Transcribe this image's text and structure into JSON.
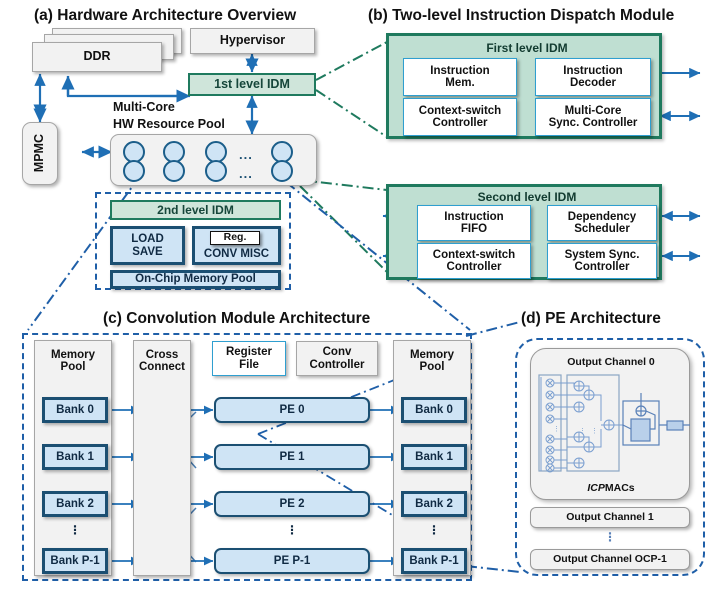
{
  "figure": {
    "panels": {
      "a": {
        "title": "(a) Hardware Architecture Overview"
      },
      "b": {
        "title": "(b) Two-level Instruction Dispatch Module"
      },
      "c": {
        "title": "(c) Convolution Module Architecture"
      },
      "d": {
        "title": "(d) PE Architecture"
      }
    }
  },
  "panel_a": {
    "ddr": "DDR",
    "hypervisor": "Hypervisor",
    "first_level_idm": "1st level IDM",
    "pool_label_line1": "Multi-Core",
    "pool_label_line2": "HW Resource Pool",
    "mpmc": "MPMC",
    "pool_ellipsis": "...",
    "core_rows": 2,
    "cores_per_row": 3
  },
  "panel_b": {
    "first": {
      "header": "First level IDM",
      "cells": [
        {
          "line1": "Instruction",
          "line2": "Mem."
        },
        {
          "line1": "Instruction",
          "line2": "Decoder"
        },
        {
          "line1": "Context-switch",
          "line2": "Controller"
        },
        {
          "line1": "Multi-Core",
          "line2": "Sync. Controller"
        }
      ]
    },
    "second": {
      "header": "Second level IDM",
      "cells": [
        {
          "line1": "Instruction",
          "line2": "FIFO"
        },
        {
          "line1": "Dependency",
          "line2": "Scheduler"
        },
        {
          "line1": "Context-switch",
          "line2": "Controller"
        },
        {
          "line1": "System Sync.",
          "line2": "Controller"
        }
      ]
    }
  },
  "panel_core": {
    "second_level_idm": "2nd  level IDM",
    "load_save_line1": "LOAD",
    "load_save_line2": "SAVE",
    "reg": "Reg.",
    "conv_misc": "CONV MISC",
    "on_chip_memory_pool": "On-Chip Memory Pool"
  },
  "panel_c": {
    "columns": [
      {
        "line1": "Memory",
        "line2": "Pool"
      },
      {
        "line1": "Cross",
        "line2": "Connect"
      },
      {
        "line1": "Register",
        "line2": "File"
      },
      {
        "line1": "Conv",
        "line2": "Controller"
      },
      {
        "line1": "Memory",
        "line2": "Pool"
      }
    ],
    "left_banks": [
      "Bank 0",
      "Bank 1",
      "Bank 2",
      "Bank P-1"
    ],
    "pes": [
      "PE 0",
      "PE 1",
      "PE 2",
      "PE P-1"
    ],
    "right_banks": [
      "Bank 0",
      "Bank 1",
      "Bank 2",
      "Bank P-1"
    ],
    "ellipsis": "⋮"
  },
  "panel_d": {
    "output_channel_0": "Output Channel 0",
    "icp_macs_italic": "ICP",
    "icp_macs_rest": " MACs",
    "output_channel_1": "Output Channel 1",
    "output_channel_last": "Output Channel OCP-1",
    "ellipsis": "⋮",
    "mac_multiplier_count": 8
  },
  "colors": {
    "idm_green_fill": "#cfe5da",
    "idm_green_border": "#1f7a5e",
    "idm_panel_fill": "#bfdfd2",
    "blue_fill": "#cfe4f5",
    "blue_border": "#1b4f72",
    "arrow_blue": "#1f6fb5",
    "grey_fill": "#f2f2f2",
    "grey_border": "#a6a6a6",
    "dash_blue": "#1f5fa8",
    "dash_green": "#1f7a5e"
  }
}
